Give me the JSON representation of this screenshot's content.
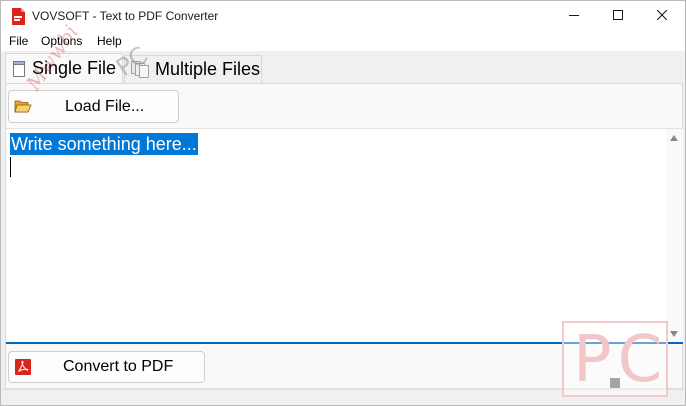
{
  "window": {
    "title": "VOVSOFT - Text to PDF Converter",
    "icon": "pdf-app-icon",
    "controls": {
      "minimize": "minimize-icon",
      "maximize": "maximize-icon",
      "close": "close-icon"
    }
  },
  "menu": {
    "items": [
      {
        "label": "File"
      },
      {
        "label": "Options"
      },
      {
        "label": "Help"
      }
    ]
  },
  "tabs": [
    {
      "label": "Single File",
      "icon": "single-file-icon",
      "selected": true
    },
    {
      "label": "Multiple Files",
      "icon": "multiple-files-icon",
      "selected": false
    }
  ],
  "single_file": {
    "load_button": {
      "label": "Load File...",
      "icon": "folder-open-icon"
    },
    "editor": {
      "text": "Write something here...",
      "selected": true
    },
    "convert_button": {
      "label": "Convert to PDF",
      "icon": "pdf-icon"
    }
  },
  "watermark": {
    "box_text": "PC",
    "diagonal_text": "Mwwbi",
    "diagonal_pc": "PC"
  },
  "colors": {
    "selection": "#0078d7",
    "accent_line": "#0067c0",
    "pdf_red": "#d9261c"
  }
}
